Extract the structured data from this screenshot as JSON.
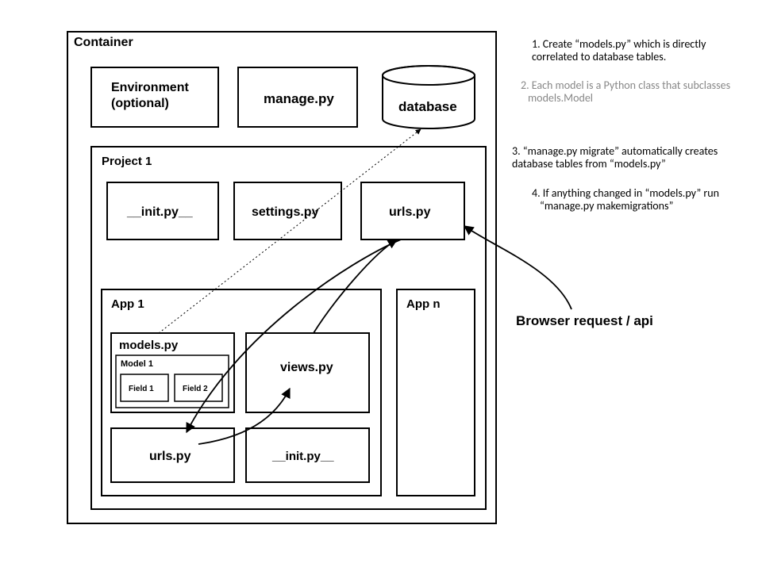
{
  "container": {
    "label": "Container"
  },
  "env": {
    "line1": "Environment",
    "line2": "(optional)"
  },
  "manage": {
    "label": "manage.py"
  },
  "database": {
    "label": "database"
  },
  "project": {
    "label": "Project 1"
  },
  "init": {
    "label": "__init.py__"
  },
  "settings": {
    "label": "settings.py"
  },
  "proj_urls": {
    "label": "urls.py"
  },
  "app1": {
    "label": "App 1"
  },
  "appn": {
    "label": "App n"
  },
  "models": {
    "label": "models.py"
  },
  "model1": {
    "label": "Model 1"
  },
  "field1": {
    "label": "Field 1"
  },
  "field2": {
    "label": "Field 2"
  },
  "views": {
    "label": "views.py"
  },
  "app_urls": {
    "label": "urls.py"
  },
  "app_init": {
    "label": "__init.py__"
  },
  "browser": {
    "label": "Browser request / api"
  },
  "notes": {
    "n1a": "1. Create “models.py” which is directly",
    "n1b": "correlated to database tables.",
    "n2a": "2. Each model is a Python class that subclasses",
    "n2b": "models.Model",
    "n3a": "3. “manage.py migrate” automatically creates",
    "n3b": "database tables from “models.py”",
    "n4a": "4. If anything changed in “models.py” run",
    "n4b": "“manage.py makemigrations”"
  }
}
